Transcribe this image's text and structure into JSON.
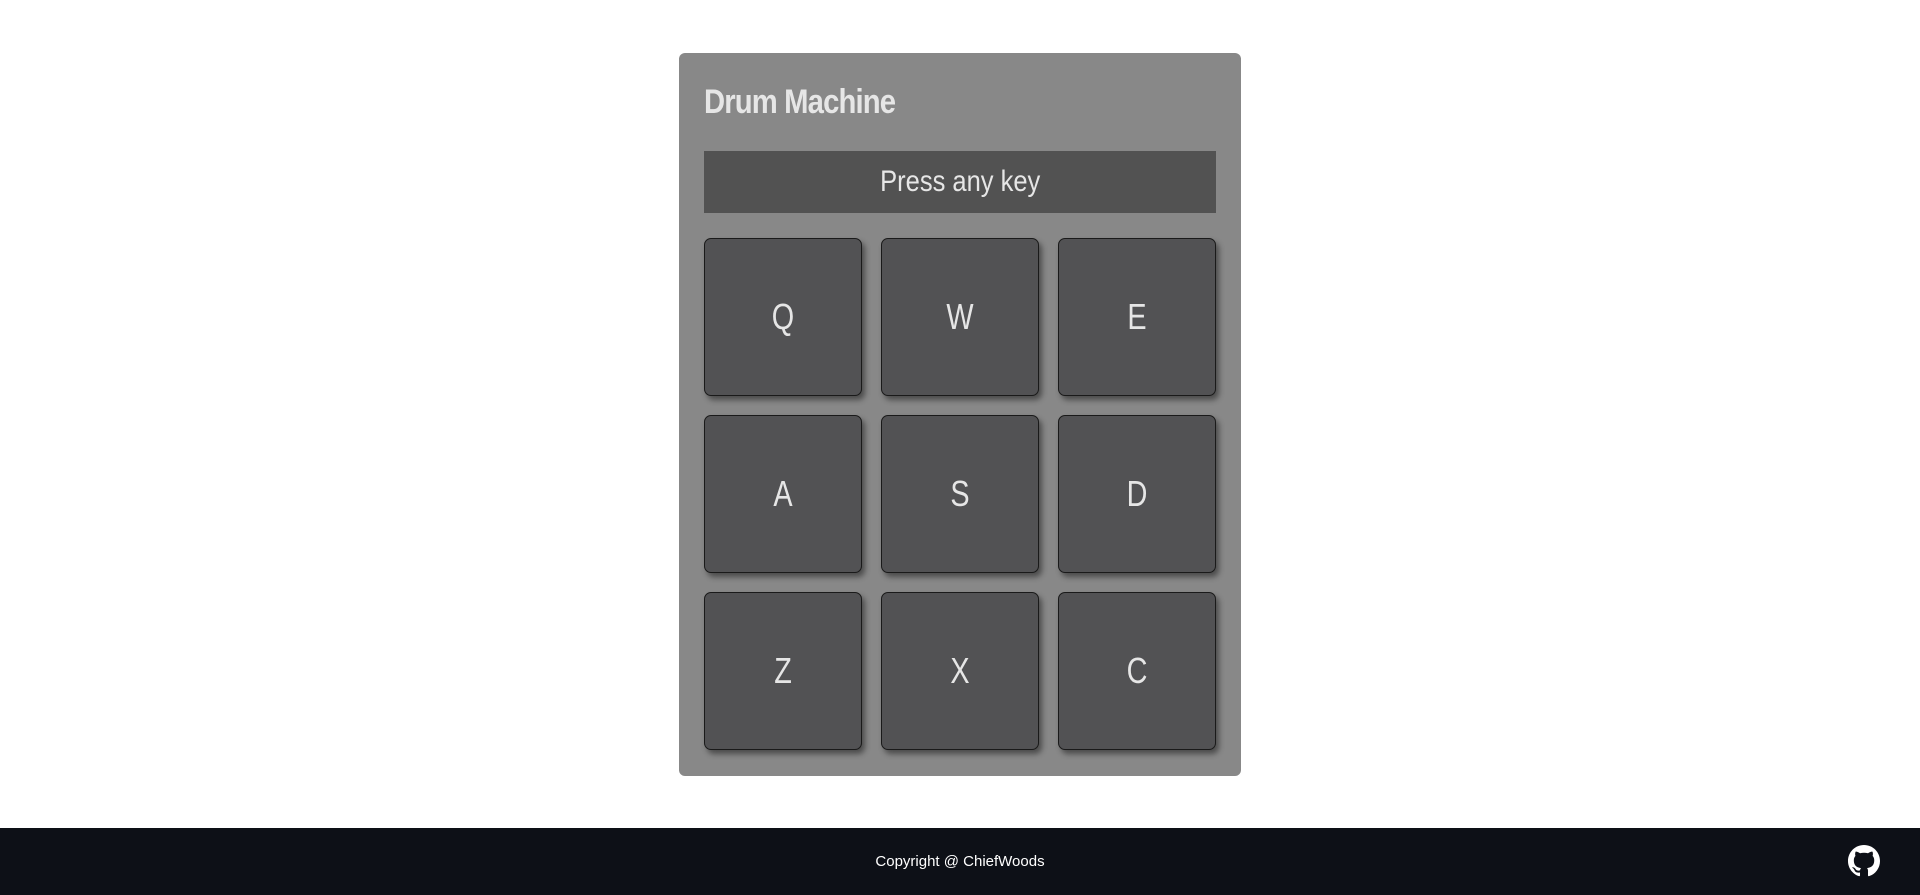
{
  "app": {
    "title": "Drum Machine",
    "display_text": "Press any key"
  },
  "pads": [
    {
      "key": "Q"
    },
    {
      "key": "W"
    },
    {
      "key": "E"
    },
    {
      "key": "A"
    },
    {
      "key": "S"
    },
    {
      "key": "D"
    },
    {
      "key": "Z"
    },
    {
      "key": "X"
    },
    {
      "key": "C"
    }
  ],
  "footer": {
    "copyright": "Copyright @ ChiefWoods",
    "github_icon": "github-icon"
  },
  "colors": {
    "panel": "#888888",
    "display": "#525252",
    "pad": "#525254",
    "footer": "#0d1017",
    "text": "#e6e6e6"
  }
}
